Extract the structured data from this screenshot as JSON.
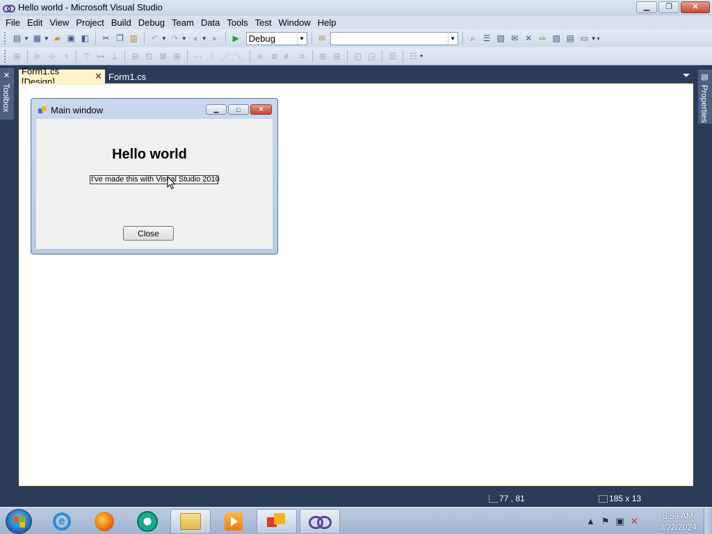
{
  "window": {
    "title": "Hello world - Microsoft Visual Studio",
    "controls": {
      "minimize": "▁",
      "restore": "❐",
      "close": "✕"
    }
  },
  "menu": [
    "File",
    "Edit",
    "View",
    "Project",
    "Build",
    "Debug",
    "Team",
    "Data",
    "Tools",
    "Test",
    "Window",
    "Help"
  ],
  "toolbar": {
    "configuration": "Debug",
    "platform": "",
    "standard_icons": [
      "new-project-icon",
      "add-item-icon",
      "open-icon",
      "save-icon",
      "save-all-icon",
      "cut-icon",
      "copy-icon",
      "paste-icon",
      "undo-icon",
      "redo-icon",
      "navigate-backward-icon",
      "navigate-forward-icon",
      "start-debugging-icon",
      "find-in-files-icon",
      "solution-explorer-icon",
      "properties-icon",
      "object-browser-icon",
      "toolbox-icon",
      "extension-manager-icon",
      "command-window-icon"
    ],
    "layout_icons": [
      "align-to-grid-icon",
      "align-lefts-icon",
      "align-centers-icon",
      "align-rights-icon",
      "align-tops-icon",
      "align-middles-icon",
      "align-bottoms-icon",
      "make-same-width-icon",
      "make-same-height-icon",
      "size-to-grid-icon",
      "horizontal-spacing-icon",
      "vertical-spacing-icon",
      "center-horizontally-icon",
      "center-vertically-icon",
      "bring-to-front-icon",
      "send-to-back-icon",
      "tab-order-icon"
    ]
  },
  "side_panels": {
    "left": "Toolbox",
    "right": "Properties"
  },
  "tabs": [
    {
      "label": "Form1.cs [Design]",
      "active": true,
      "close": "✕"
    },
    {
      "label": "Form1.cs",
      "active": false
    }
  ],
  "form": {
    "title": "Main window",
    "heading": "Hello world",
    "label": "I've made this with Visual Studio 2010",
    "button": "Close"
  },
  "status": {
    "position": "77 , 81",
    "size": "185 x 13"
  },
  "taskbar": {
    "apps": [
      "internet-explorer-icon",
      "firefox-icon",
      "chrome-icon",
      "file-explorer-icon",
      "media-player-icon",
      "office-icon",
      "visual-studio-icon"
    ],
    "clock_time": "5:59 AM",
    "clock_date": "3/22/2024"
  }
}
